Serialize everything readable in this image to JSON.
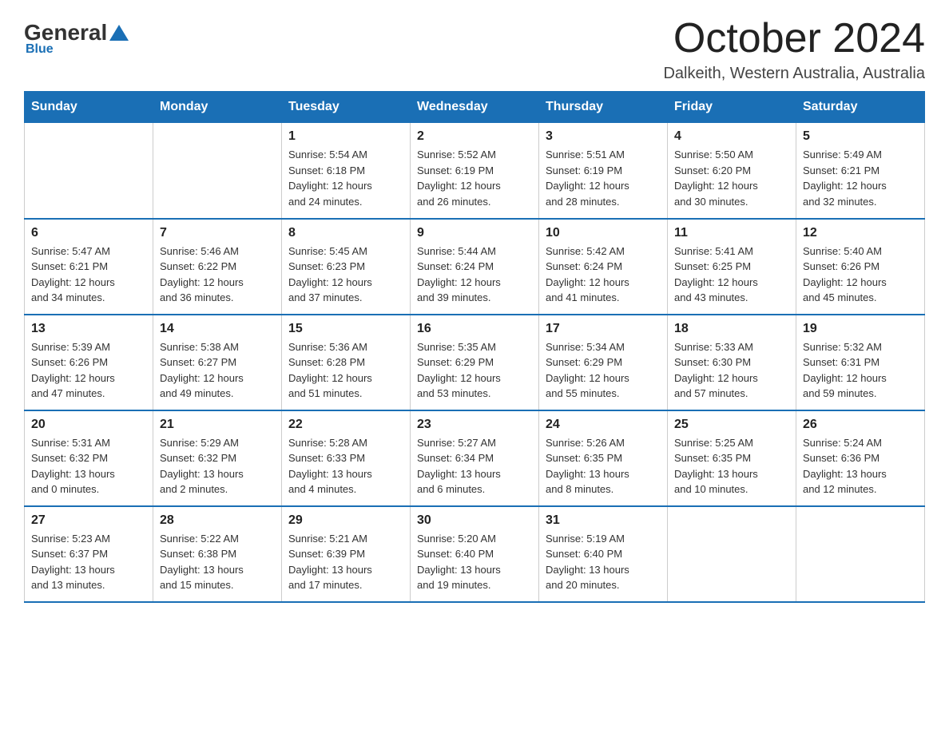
{
  "logo": {
    "general": "General",
    "blue": "Blue",
    "subtitle": "Blue"
  },
  "header": {
    "month_title": "October 2024",
    "location": "Dalkeith, Western Australia, Australia"
  },
  "days_of_week": [
    "Sunday",
    "Monday",
    "Tuesday",
    "Wednesday",
    "Thursday",
    "Friday",
    "Saturday"
  ],
  "weeks": [
    [
      {
        "day": "",
        "info": ""
      },
      {
        "day": "",
        "info": ""
      },
      {
        "day": "1",
        "info": "Sunrise: 5:54 AM\nSunset: 6:18 PM\nDaylight: 12 hours\nand 24 minutes."
      },
      {
        "day": "2",
        "info": "Sunrise: 5:52 AM\nSunset: 6:19 PM\nDaylight: 12 hours\nand 26 minutes."
      },
      {
        "day": "3",
        "info": "Sunrise: 5:51 AM\nSunset: 6:19 PM\nDaylight: 12 hours\nand 28 minutes."
      },
      {
        "day": "4",
        "info": "Sunrise: 5:50 AM\nSunset: 6:20 PM\nDaylight: 12 hours\nand 30 minutes."
      },
      {
        "day": "5",
        "info": "Sunrise: 5:49 AM\nSunset: 6:21 PM\nDaylight: 12 hours\nand 32 minutes."
      }
    ],
    [
      {
        "day": "6",
        "info": "Sunrise: 5:47 AM\nSunset: 6:21 PM\nDaylight: 12 hours\nand 34 minutes."
      },
      {
        "day": "7",
        "info": "Sunrise: 5:46 AM\nSunset: 6:22 PM\nDaylight: 12 hours\nand 36 minutes."
      },
      {
        "day": "8",
        "info": "Sunrise: 5:45 AM\nSunset: 6:23 PM\nDaylight: 12 hours\nand 37 minutes."
      },
      {
        "day": "9",
        "info": "Sunrise: 5:44 AM\nSunset: 6:24 PM\nDaylight: 12 hours\nand 39 minutes."
      },
      {
        "day": "10",
        "info": "Sunrise: 5:42 AM\nSunset: 6:24 PM\nDaylight: 12 hours\nand 41 minutes."
      },
      {
        "day": "11",
        "info": "Sunrise: 5:41 AM\nSunset: 6:25 PM\nDaylight: 12 hours\nand 43 minutes."
      },
      {
        "day": "12",
        "info": "Sunrise: 5:40 AM\nSunset: 6:26 PM\nDaylight: 12 hours\nand 45 minutes."
      }
    ],
    [
      {
        "day": "13",
        "info": "Sunrise: 5:39 AM\nSunset: 6:26 PM\nDaylight: 12 hours\nand 47 minutes."
      },
      {
        "day": "14",
        "info": "Sunrise: 5:38 AM\nSunset: 6:27 PM\nDaylight: 12 hours\nand 49 minutes."
      },
      {
        "day": "15",
        "info": "Sunrise: 5:36 AM\nSunset: 6:28 PM\nDaylight: 12 hours\nand 51 minutes."
      },
      {
        "day": "16",
        "info": "Sunrise: 5:35 AM\nSunset: 6:29 PM\nDaylight: 12 hours\nand 53 minutes."
      },
      {
        "day": "17",
        "info": "Sunrise: 5:34 AM\nSunset: 6:29 PM\nDaylight: 12 hours\nand 55 minutes."
      },
      {
        "day": "18",
        "info": "Sunrise: 5:33 AM\nSunset: 6:30 PM\nDaylight: 12 hours\nand 57 minutes."
      },
      {
        "day": "19",
        "info": "Sunrise: 5:32 AM\nSunset: 6:31 PM\nDaylight: 12 hours\nand 59 minutes."
      }
    ],
    [
      {
        "day": "20",
        "info": "Sunrise: 5:31 AM\nSunset: 6:32 PM\nDaylight: 13 hours\nand 0 minutes."
      },
      {
        "day": "21",
        "info": "Sunrise: 5:29 AM\nSunset: 6:32 PM\nDaylight: 13 hours\nand 2 minutes."
      },
      {
        "day": "22",
        "info": "Sunrise: 5:28 AM\nSunset: 6:33 PM\nDaylight: 13 hours\nand 4 minutes."
      },
      {
        "day": "23",
        "info": "Sunrise: 5:27 AM\nSunset: 6:34 PM\nDaylight: 13 hours\nand 6 minutes."
      },
      {
        "day": "24",
        "info": "Sunrise: 5:26 AM\nSunset: 6:35 PM\nDaylight: 13 hours\nand 8 minutes."
      },
      {
        "day": "25",
        "info": "Sunrise: 5:25 AM\nSunset: 6:35 PM\nDaylight: 13 hours\nand 10 minutes."
      },
      {
        "day": "26",
        "info": "Sunrise: 5:24 AM\nSunset: 6:36 PM\nDaylight: 13 hours\nand 12 minutes."
      }
    ],
    [
      {
        "day": "27",
        "info": "Sunrise: 5:23 AM\nSunset: 6:37 PM\nDaylight: 13 hours\nand 13 minutes."
      },
      {
        "day": "28",
        "info": "Sunrise: 5:22 AM\nSunset: 6:38 PM\nDaylight: 13 hours\nand 15 minutes."
      },
      {
        "day": "29",
        "info": "Sunrise: 5:21 AM\nSunset: 6:39 PM\nDaylight: 13 hours\nand 17 minutes."
      },
      {
        "day": "30",
        "info": "Sunrise: 5:20 AM\nSunset: 6:40 PM\nDaylight: 13 hours\nand 19 minutes."
      },
      {
        "day": "31",
        "info": "Sunrise: 5:19 AM\nSunset: 6:40 PM\nDaylight: 13 hours\nand 20 minutes."
      },
      {
        "day": "",
        "info": ""
      },
      {
        "day": "",
        "info": ""
      }
    ]
  ]
}
